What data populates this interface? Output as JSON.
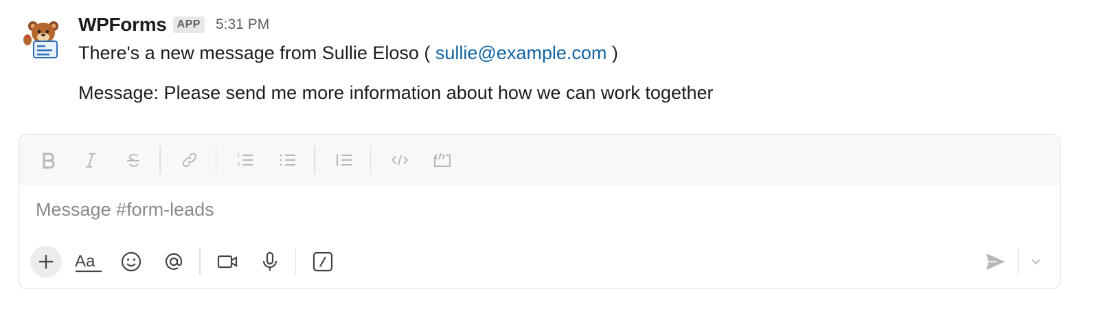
{
  "message": {
    "sender": "WPForms",
    "badge": "APP",
    "time": "5:31 PM",
    "line1_prefix": "There's a new message from Sullie Eloso ( ",
    "line1_link": "sullie@example.com",
    "line1_suffix": " )",
    "line2": "Message: Please send me more information about how we can work together"
  },
  "composer": {
    "placeholder": "Message #form-leads",
    "format_icons": [
      "bold-icon",
      "italic-icon",
      "strikethrough-icon",
      "link-icon",
      "ordered-list-icon",
      "bulleted-list-icon",
      "blockquote-icon",
      "code-icon",
      "code-block-icon"
    ],
    "action_icons": [
      "plus-icon",
      "formatting-icon",
      "emoji-icon",
      "mention-icon",
      "video-icon",
      "microphone-icon",
      "shortcuts-icon",
      "send-icon",
      "chevron-down-icon"
    ]
  },
  "colors": {
    "link": "#1264a3",
    "text": "#1d1c1d",
    "muted": "#616061",
    "disabled_icon": "#b8b8b8"
  }
}
